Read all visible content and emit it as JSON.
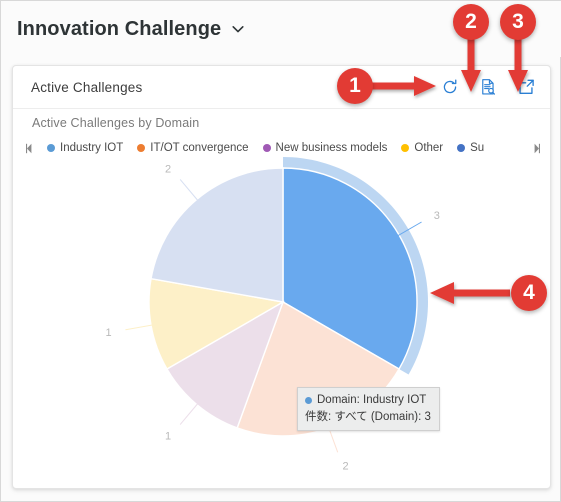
{
  "page": {
    "title": "Innovation Challenge",
    "title_chevron_icon": "chevron-down-icon"
  },
  "card": {
    "title": "Active Challenges",
    "actions": [
      {
        "name": "refresh",
        "label": "Refresh",
        "icon": "refresh-icon"
      },
      {
        "name": "report",
        "label": "View report",
        "icon": "document-search-icon"
      },
      {
        "name": "popout",
        "label": "Open in new window",
        "icon": "external-link-icon"
      }
    ]
  },
  "chart_data": {
    "type": "pie",
    "title": "Active Challenges by Domain",
    "xlabel": "",
    "ylabel": "",
    "legend_position": "top",
    "legend_scroll_left_icon": "caret-left-icon",
    "legend_scroll_right_icon": "caret-right-icon",
    "measure_label": "件数: すべて (Domain)",
    "categories": [
      "Industry IOT",
      "IT/OT convergence",
      "New business models",
      "Other",
      "Su"
    ],
    "values": [
      3,
      2,
      1,
      1,
      2
    ],
    "labels": [
      "3",
      "2",
      "1",
      "1",
      "2"
    ],
    "colors": [
      "#69a9ee",
      "#fce2d5",
      "#ecdfea",
      "#fdf0c8",
      "#d7e0f2"
    ],
    "legend_colors": [
      "#5b9bd5",
      "#ed7d31",
      "#a05ab5",
      "#ffc000",
      "#4472c4"
    ],
    "highlighted_slice": "Industry IOT",
    "highlight_ring_color": "#bcd6f2"
  },
  "tooltip": {
    "visible": true,
    "dot_color": "#5b9bd5",
    "line1": "Domain: Industry IOT",
    "line2": "件数: すべて (Domain): 3"
  },
  "annotations": {
    "marker_color": "#e23b34",
    "items": [
      {
        "number": "1",
        "target": "refresh-icon"
      },
      {
        "number": "2",
        "target": "document-search-icon"
      },
      {
        "number": "3",
        "target": "external-link-icon"
      },
      {
        "number": "4",
        "target": "chart-tooltip"
      }
    ]
  }
}
